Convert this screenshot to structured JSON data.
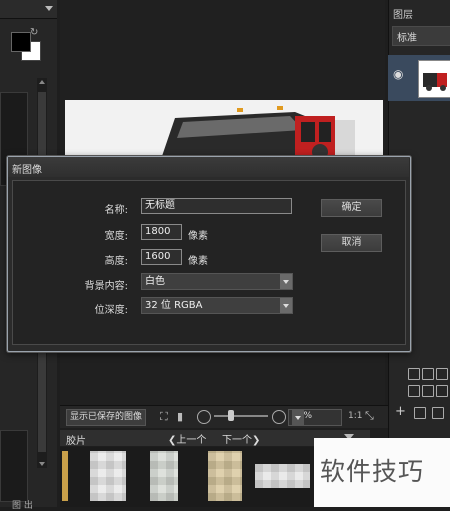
{
  "layers_panel": {
    "title": "图层",
    "blend_mode": "标准"
  },
  "dialog": {
    "title": "新图像",
    "name_label": "名称:",
    "name_value": "无标题",
    "width_label": "宽度:",
    "width_value": "1800",
    "width_unit": "像素",
    "height_label": "高度:",
    "height_value": "1600",
    "height_unit": "像素",
    "bg_label": "背景内容:",
    "bg_value": "白色",
    "depth_label": "位深度:",
    "depth_value": "32 位 RGBA",
    "ok_label": "确定",
    "cancel_label": "取消"
  },
  "statusbar": {
    "show_saved_label": "显示已保存的图像",
    "zoom_value": "76%",
    "ratio_label": "1:1"
  },
  "filmstrip": {
    "title": "胶片",
    "prev_label": "上一个",
    "next_label": "下一个"
  },
  "watermark": {
    "text": "软件技巧"
  },
  "left_panel": {
    "bottom_label": "图 出"
  },
  "colors": {
    "dialog_border": "#9aa3ad",
    "selected_layer": "#3a4a5e",
    "field_border": "#8a8a8a"
  },
  "icons": [
    "swap-colors-icon",
    "eye-icon",
    "zoom-out-icon",
    "zoom-in-icon",
    "histogram-icon",
    "fit-icon",
    "chevron-left-icon",
    "chevron-right-icon"
  ]
}
